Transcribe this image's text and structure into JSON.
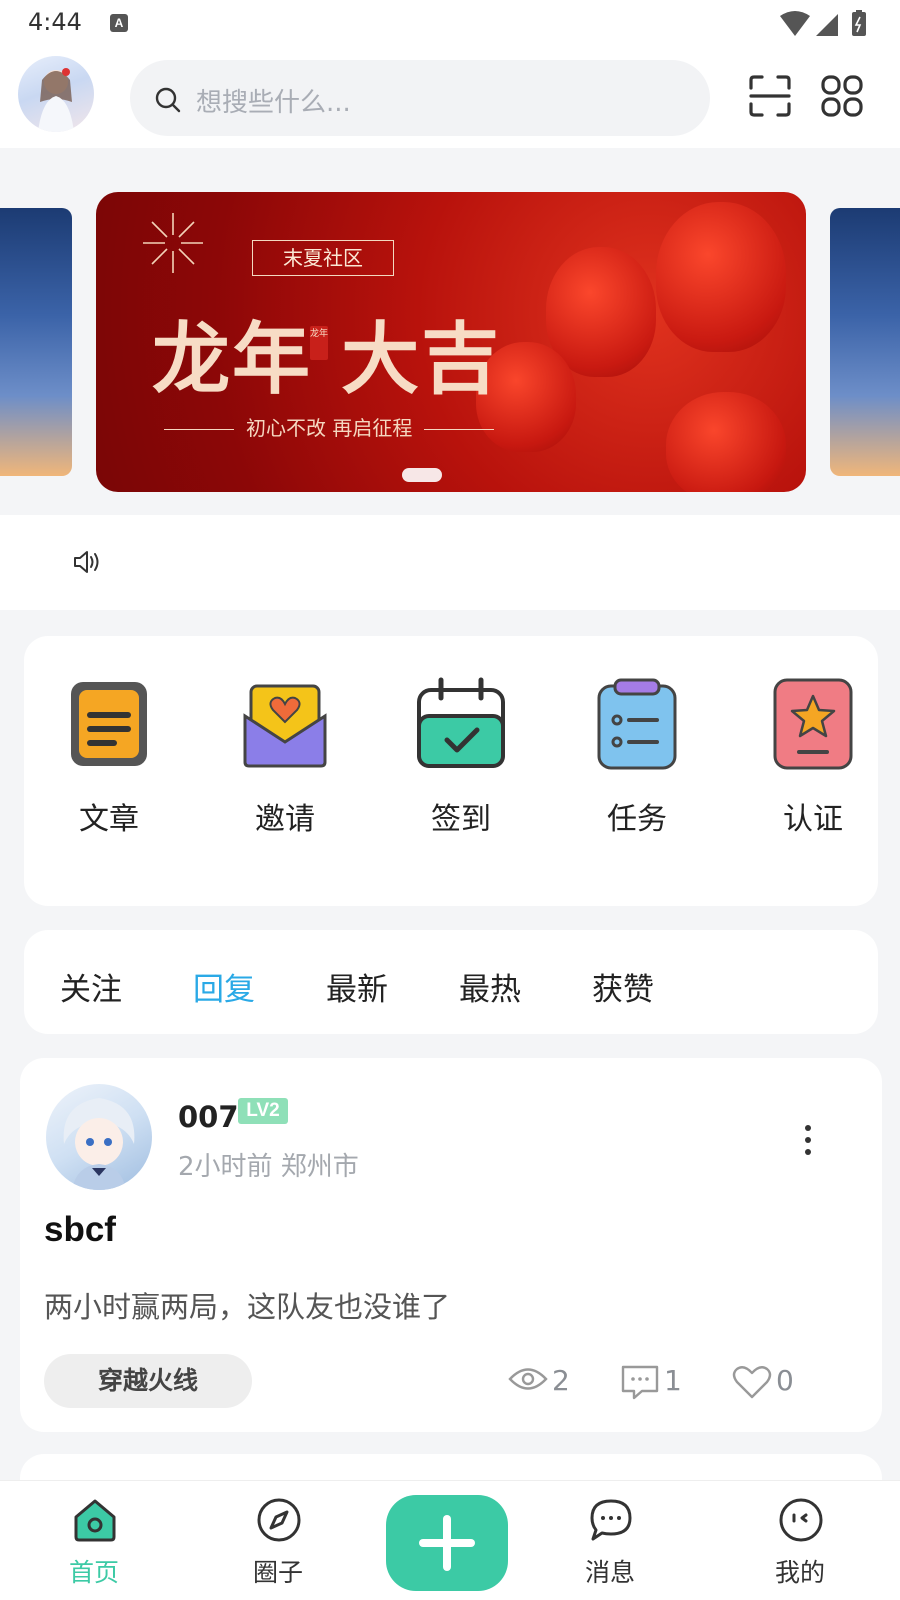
{
  "status_bar": {
    "time": "4:44",
    "notification_glyph": "A"
  },
  "search": {
    "placeholder": "想搜些什么..."
  },
  "banner": {
    "tag": "末夏社区",
    "title": "龙年 大吉",
    "seal": "龙年",
    "subtitle": "初心不改 再启征程"
  },
  "quick_actions": [
    {
      "label": "文章",
      "icon": "article-icon"
    },
    {
      "label": "邀请",
      "icon": "invite-icon"
    },
    {
      "label": "签到",
      "icon": "checkin-icon"
    },
    {
      "label": "任务",
      "icon": "task-icon"
    },
    {
      "label": "认证",
      "icon": "certify-icon"
    }
  ],
  "tabs": [
    {
      "label": "关注",
      "active": false
    },
    {
      "label": "回复",
      "active": true
    },
    {
      "label": "最新",
      "active": false
    },
    {
      "label": "最热",
      "active": false
    },
    {
      "label": "获赞",
      "active": false
    }
  ],
  "post": {
    "username": "007",
    "level": "LV2",
    "meta": "2小时前 郑州市",
    "title": "sbcf",
    "body": "两小时赢两局，这队友也没谁了",
    "topic": "穿越火线",
    "views": "2",
    "comments": "1",
    "likes": "0"
  },
  "bottom_nav": [
    {
      "label": "首页",
      "icon": "home-icon",
      "active": true
    },
    {
      "label": "圈子",
      "icon": "compass-icon",
      "active": false
    },
    {
      "label": "消息",
      "icon": "message-icon",
      "active": false
    },
    {
      "label": "我的",
      "icon": "profile-icon",
      "active": false
    }
  ],
  "colors": {
    "accent": "#3ccaa5",
    "tab_active": "#2aa9e6",
    "banner_red": "#b8120c"
  }
}
